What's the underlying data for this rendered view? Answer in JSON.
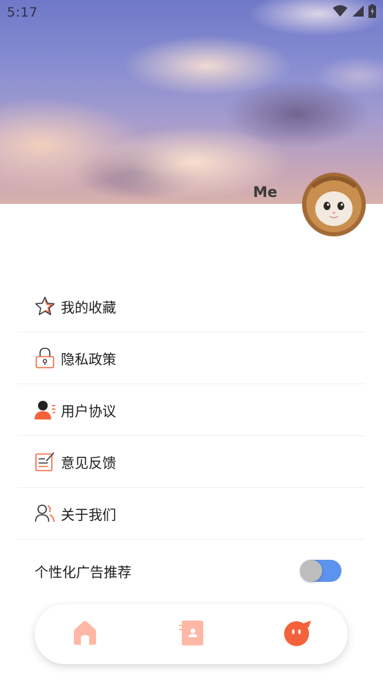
{
  "status_bar": {
    "time": "5:17",
    "icons": [
      "wifi-icon",
      "cellular-signal-icon",
      "battery-icon"
    ]
  },
  "profile": {
    "name": "Me",
    "avatar": "kitten-in-lion-hat-avatar"
  },
  "menu": {
    "items": [
      {
        "label": "我的收藏",
        "icon": "star-icon"
      },
      {
        "label": "隐私政策",
        "icon": "lock-icon"
      },
      {
        "label": "用户协议",
        "icon": "user-agreement-icon"
      },
      {
        "label": "意见反馈",
        "icon": "feedback-edit-icon"
      },
      {
        "label": "关于我们",
        "icon": "about-us-icon"
      }
    ]
  },
  "ads_setting": {
    "label": "个性化广告推荐",
    "enabled": true
  },
  "bottom_nav": {
    "items": [
      {
        "icon": "home-icon",
        "active": false
      },
      {
        "icon": "contacts-icon",
        "active": false
      },
      {
        "icon": "profile-mascot-icon",
        "active": true
      }
    ]
  },
  "colors": {
    "accent": "#f3623a",
    "accent_light": "#ffb7a6",
    "toggle_on": "#5b93ee",
    "text": "#1e1e1e"
  }
}
